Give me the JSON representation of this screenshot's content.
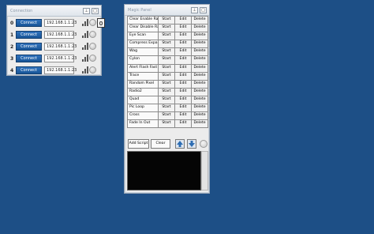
{
  "connection": {
    "title": "Connection",
    "controls": {
      "pin": "⊥",
      "close": "□"
    },
    "rows": [
      {
        "num": "0",
        "button": "Connect",
        "ip": "192.168.1.1:23"
      },
      {
        "num": "1",
        "button": "Connect",
        "ip": "192.168.1.1:23"
      },
      {
        "num": "2",
        "button": "Connect",
        "ip": "192.168.1.1:23"
      },
      {
        "num": "3",
        "button": "Connect",
        "ip": "192.168.1.1:23"
      },
      {
        "num": "4",
        "button": "Connect",
        "ip": "192.168.1.1:23"
      }
    ]
  },
  "magic": {
    "title": "Magic Panel",
    "controls": {
      "pin": "⊥",
      "close": "□"
    },
    "items": [
      {
        "name": "Clear Enable Ran...",
        "start": "Start",
        "edit": "Edit",
        "delete": "Delete"
      },
      {
        "name": "Clear Disable Ra...",
        "start": "Start",
        "edit": "Edit",
        "delete": "Delete"
      },
      {
        "name": "Eye Scan",
        "start": "Start",
        "edit": "Edit",
        "delete": "Delete"
      },
      {
        "name": "Compress Expand",
        "start": "Start",
        "edit": "Edit",
        "delete": "Delete"
      },
      {
        "name": "Wag",
        "start": "Start",
        "edit": "Edit",
        "delete": "Delete"
      },
      {
        "name": "Cylon",
        "start": "Start",
        "edit": "Edit",
        "delete": "Delete"
      },
      {
        "name": "Alert Flash Fast",
        "start": "Start",
        "edit": "Edit",
        "delete": "Delete"
      },
      {
        "name": "Trace",
        "start": "Start",
        "edit": "Edit",
        "delete": "Delete"
      },
      {
        "name": "Random Pixel",
        "start": "Start",
        "edit": "Edit",
        "delete": "Delete"
      },
      {
        "name": "Radio2",
        "start": "Start",
        "edit": "Edit",
        "delete": "Delete"
      },
      {
        "name": "Quad",
        "start": "Start",
        "edit": "Edit",
        "delete": "Delete"
      },
      {
        "name": "Pic Loop",
        "start": "Start",
        "edit": "Edit",
        "delete": "Delete"
      },
      {
        "name": "Cross",
        "start": "Start",
        "edit": "Edit",
        "delete": "Delete"
      },
      {
        "name": "Fade In Out",
        "start": "Start",
        "edit": "Edit",
        "delete": "Delete"
      }
    ],
    "toolbar": {
      "add": "Add Script",
      "clear": "Clear"
    }
  },
  "colors": {
    "desktop": "#1d4f86",
    "accent": "#185597"
  }
}
